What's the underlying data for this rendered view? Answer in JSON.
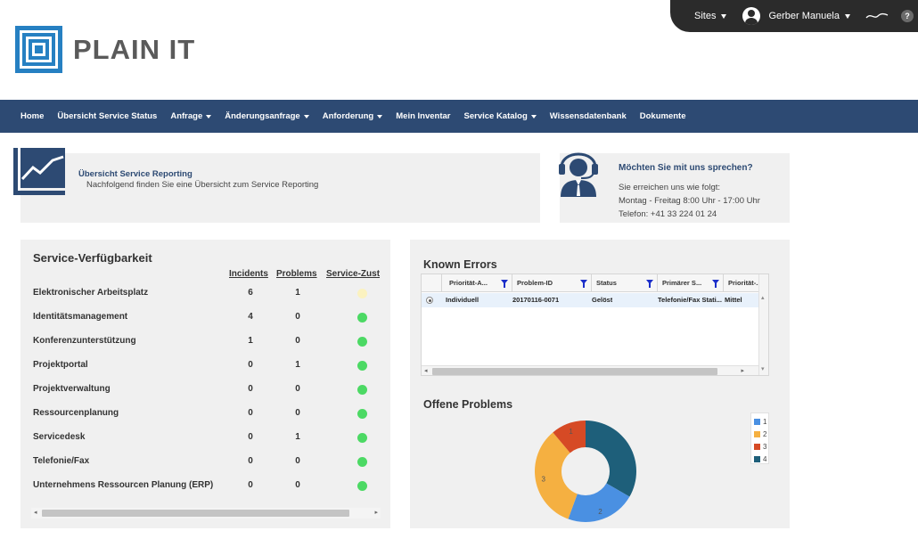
{
  "topbar": {
    "sites_label": "Sites",
    "user_name": "Gerber Manuela",
    "help_label": "?"
  },
  "logo": {
    "text": "PLAIN IT"
  },
  "nav": {
    "home": "Home",
    "service_status": "Übersicht Service Status",
    "anfrage": "Anfrage",
    "aenderungsanfrage": "Änderungsanfrage",
    "anforderung": "Anforderung",
    "inventar": "Mein Inventar",
    "katalog": "Service Katalog",
    "wissensdatenbank": "Wissensdatenbank",
    "dokumente": "Dokumente"
  },
  "reporting": {
    "title": "Übersicht Service Reporting",
    "subtitle": "Nachfolgend finden Sie eine Übersicht zum Service Reporting"
  },
  "contact": {
    "title": "Möchten Sie mit uns sprechen?",
    "line1": "Sie erreichen uns wie folgt:",
    "line2": "Montag - Freitag 8:00 Uhr - 17:00 Uhr",
    "line3": "Telefon: +41 33 224 01 24"
  },
  "availability": {
    "title": "Service-Verfügbarkeit",
    "headers": {
      "incidents": "Incidents",
      "problems": "Problems",
      "status": "Service-Zust"
    },
    "colors": {
      "green": "#4cd964",
      "yellow": "#fbf2c0"
    },
    "rows": [
      {
        "name": "Elektronischer Arbeitsplatz",
        "incidents": "6",
        "problems": "1",
        "status": "yellow"
      },
      {
        "name": "Identitätsmanagement",
        "incidents": "4",
        "problems": "0",
        "status": "green"
      },
      {
        "name": "Konferenzunterstützung",
        "incidents": "1",
        "problems": "0",
        "status": "green"
      },
      {
        "name": "Projektportal",
        "incidents": "0",
        "problems": "1",
        "status": "green"
      },
      {
        "name": "Projektverwaltung",
        "incidents": "0",
        "problems": "0",
        "status": "green"
      },
      {
        "name": "Ressourcenplanung",
        "incidents": "0",
        "problems": "0",
        "status": "green"
      },
      {
        "name": "Servicedesk",
        "incidents": "0",
        "problems": "1",
        "status": "green"
      },
      {
        "name": "Telefonie/Fax",
        "incidents": "0",
        "problems": "0",
        "status": "green"
      },
      {
        "name": "Unternehmens Ressourcen Planung (ERP)",
        "incidents": "0",
        "problems": "0",
        "status": "green"
      }
    ]
  },
  "known_errors": {
    "title": "Known Errors",
    "columns": [
      "Priorität-A...",
      "Problem-ID",
      "Status",
      "Primärer S...",
      "Priorität-..."
    ],
    "row": [
      "Individuell",
      "20170116-0071",
      "Gelöst",
      "Telefonie/Fax Stati...",
      "Mittel"
    ]
  },
  "offene_problems": {
    "title": "Offene Problems",
    "legend": [
      {
        "label": "1",
        "color": "#4a90e2"
      },
      {
        "label": "2",
        "color": "#f5b041"
      },
      {
        "label": "3",
        "color": "#d64a25"
      },
      {
        "label": "4",
        "color": "#1e5f7a"
      }
    ]
  },
  "chart_data": {
    "type": "pie",
    "donut": true,
    "categories": [
      "1",
      "2",
      "3",
      "4"
    ],
    "values": [
      2,
      3,
      1,
      3
    ],
    "slice_labels": [
      "2",
      "3",
      "1",
      ""
    ],
    "colors": [
      "#4a90e2",
      "#f5b041",
      "#d64a25",
      "#1e5f7a"
    ]
  }
}
